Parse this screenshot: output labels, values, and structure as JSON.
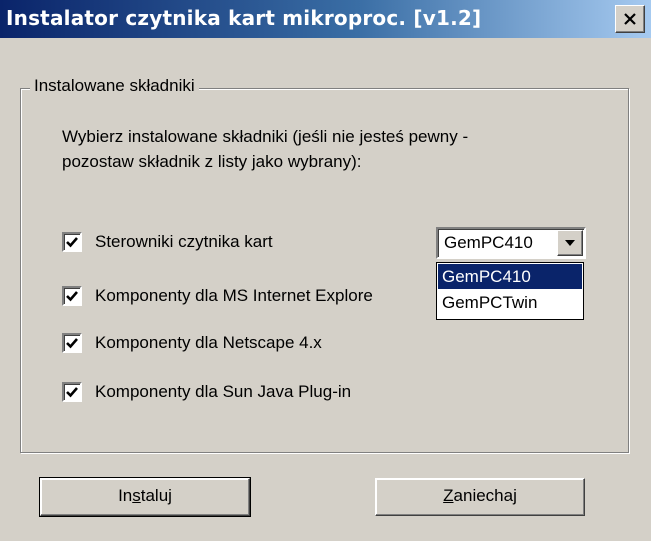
{
  "window": {
    "title": "Instalator czytnika kart mikroproc. [v1.2]",
    "close_icon": "close-icon",
    "accent_color": "#0a246a"
  },
  "group": {
    "legend": "Instalowane składniki",
    "instruction_line1": "Wybierz instalowane składniki (jeśli nie jesteś pewny -",
    "instruction_line2": "pozostaw składnik z listy jako wybrany):"
  },
  "components": [
    {
      "label": "Sterowniki czytnika kart",
      "checked": true
    },
    {
      "label": "Komponenty dla MS Internet Explore",
      "checked": true
    },
    {
      "label": "Komponenty dla Netscape 4.x",
      "checked": true
    },
    {
      "label": "Komponenty dla Sun Java Plug-in",
      "checked": true
    }
  ],
  "reader_select": {
    "value": "GemPC410",
    "options": [
      "GemPC410",
      "GemPCTwin"
    ],
    "highlighted_option": "GemPC410"
  },
  "buttons": {
    "install_pre": "In",
    "install_mnemonic": "s",
    "install_post": "taluj",
    "cancel_mnemonic": "Z",
    "cancel_post": "aniechaj"
  }
}
